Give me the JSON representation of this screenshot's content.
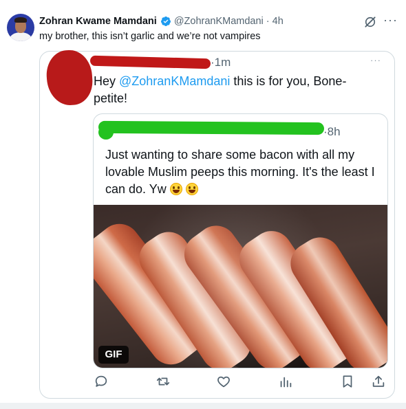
{
  "tweet": {
    "author_name": "Zohran Kwame Mamdani",
    "handle": "@ZohranKMamdani",
    "separator": "·",
    "time": "4h",
    "text": "my brother, this isn’t garlic and we’re not vampires"
  },
  "quote1": {
    "separator": "·",
    "time": "1m",
    "text_prefix": "Hey ",
    "mention": "@ZohranKMamdani",
    "text_suffix": " this is for you, Bone-petite!",
    "more": "···"
  },
  "quote2": {
    "separator": "·",
    "time": "8h",
    "text": "Just wanting to share some bacon with all my lovable Muslim peeps this morning. It's the least I can do. Yw"
  },
  "media": {
    "badge": "GIF"
  },
  "header_more": "···",
  "icons": {
    "verified": "verified-badge-icon",
    "grok": "grok-icon",
    "reply": "reply-icon",
    "retweet": "retweet-icon",
    "like": "like-icon",
    "views": "views-icon",
    "bookmark": "bookmark-icon",
    "share": "share-icon"
  },
  "colors": {
    "accent": "#1d9bf0",
    "text": "#0f1419",
    "secondary": "#536471",
    "redaction_red": "#c01818",
    "redaction_green": "#23c21f"
  }
}
